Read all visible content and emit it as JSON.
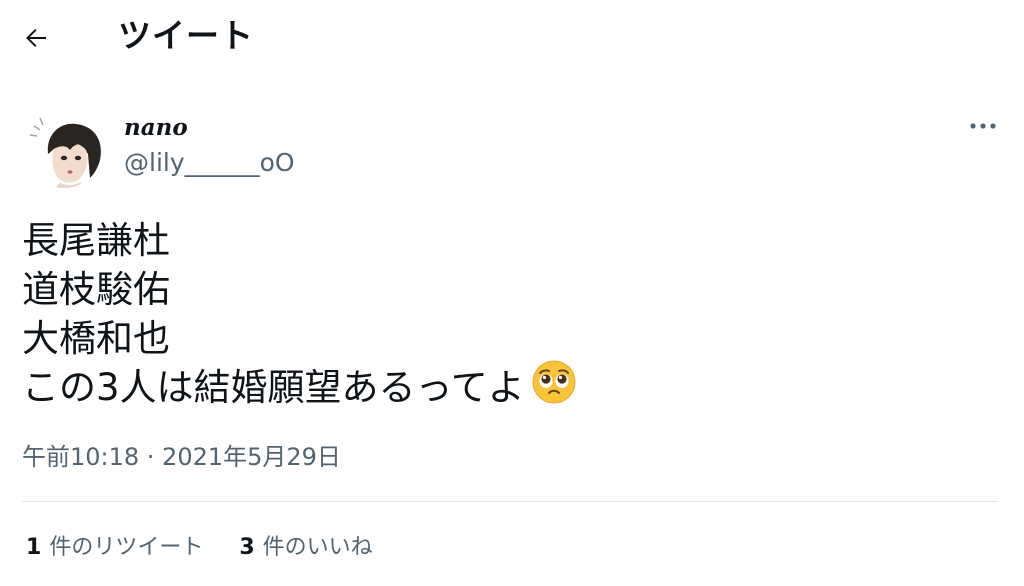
{
  "header": {
    "title": "ツイート",
    "back_icon": "arrow-left-icon"
  },
  "tweet": {
    "author": {
      "display_name": "nano",
      "handle": "@lily______oO",
      "avatar": "avatar-photo"
    },
    "more_icon": "more-horizontal-icon",
    "text_lines": [
      "長尾謙杜",
      "道枝駿佑",
      "大橋和也",
      "この3人は結婚願望あるってよ"
    ],
    "emoji": "pleading-face-emoji",
    "timestamp": "午前10:18 · 2021年5月29日",
    "stats": {
      "retweets_count": "1",
      "retweets_label": "件のリツイート",
      "likes_count": "3",
      "likes_label": "件のいいね"
    }
  },
  "colors": {
    "text_primary": "#0f1419",
    "text_secondary": "#536471",
    "divider": "#e2e6e9",
    "background": "#ffffff"
  }
}
